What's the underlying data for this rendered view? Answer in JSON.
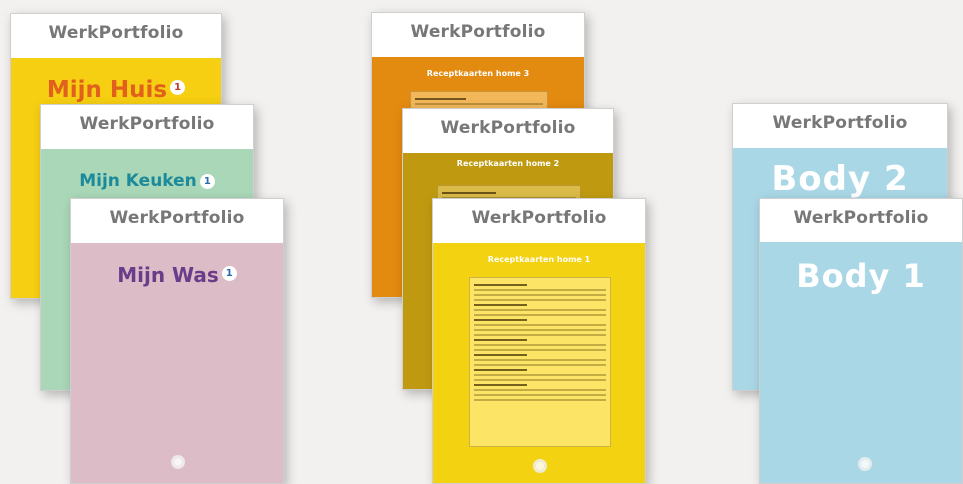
{
  "brand": "WerkPortfolio",
  "group1": {
    "huis": {
      "title": "Mijn Huis",
      "badge": "1",
      "bg": "#f6cf12",
      "title_color": "#e0601c"
    },
    "keuken": {
      "title": "Mijn Keuken",
      "badge": "1",
      "bg": "#a9d7b8",
      "title_color": "#1c8a9a"
    },
    "was": {
      "title": "Mijn Was",
      "badge": "1",
      "bg": "#dcbcc6",
      "title_color": "#6a3c8a"
    }
  },
  "group2": {
    "book3": {
      "title": "Receptkaarten home 3",
      "bg": "#e38a10"
    },
    "book2": {
      "title": "Receptkaarten home 2",
      "bg": "#bf9a10"
    },
    "book1": {
      "title": "Receptkaarten home 1",
      "bg": "#f3d212"
    }
  },
  "group3": {
    "body2": {
      "title": "Body 2",
      "bg": "#a9d7e6"
    },
    "body1": {
      "title": "Body 1",
      "bg": "#a9d7e6"
    }
  },
  "colors": {
    "brand_text": "#777777",
    "page_bg": "#f2f1ef"
  }
}
